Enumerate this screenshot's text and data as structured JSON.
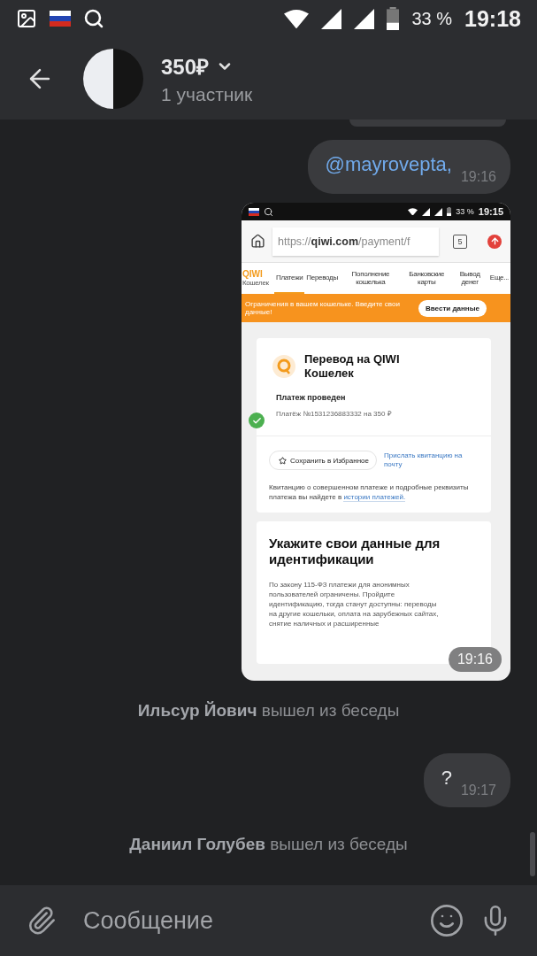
{
  "status_bar": {
    "battery": "33 %",
    "time": "19:18"
  },
  "header": {
    "title": "350₽",
    "subtitle": "1 участник"
  },
  "messages": [
    {
      "kind": "cut_off"
    },
    {
      "kind": "mention",
      "text": "@mayrovepta,",
      "time": "19:16"
    },
    {
      "kind": "screenshot",
      "time": "19:16",
      "screen": {
        "status_bar": {
          "battery": "33 %",
          "time": "19:15"
        },
        "browser": {
          "url": "https://**qiwi.com**/payment/f",
          "tab_count": "5"
        },
        "nav": {
          "logo": "QIWI",
          "logo_caption": "Кошелек",
          "items": [
            {
              "label": "Платежи",
              "selected": true
            },
            {
              "label": "Переводы",
              "selected": false
            },
            {
              "label": "Пополнение кошелька",
              "selected": false
            },
            {
              "label": "Банковские карты",
              "selected": false
            },
            {
              "label": "Вывод денег",
              "selected": false
            },
            {
              "label": "Еще...",
              "selected": false
            }
          ]
        },
        "banner": {
          "text": "Ограничения в вашем кошельке. Введите свои данные!",
          "button": "Ввести данные"
        },
        "payment_card": {
          "title": "Перевод на QIWI Кошелек",
          "status": "Платеж проведен",
          "detail": "Платёж №1531236883332 на 350 ₽",
          "save_button": "Сохранить в Избранное",
          "receipt_link": "Прислать квитанцию на почту",
          "note": "Квитанцию о совершенном платеже и подробные реквизиты платежа вы найдете в",
          "note_link": "истории платежей."
        },
        "identification_card": {
          "title": "Укажите свои данные для идентификации",
          "body": "По закону 115-ФЗ платежи для анонимных пользователей ограничены. Пройдите идентификацию, тогда станут доступны: переводы на другие кошельки, оплата на зарубежных сайтах, снятие наличных и расширенные"
        }
      }
    },
    {
      "kind": "system",
      "actor": "Ильсур Йович",
      "text": "вышел из беседы"
    },
    {
      "kind": "text",
      "text": "?",
      "time": "19:17"
    },
    {
      "kind": "system",
      "actor": "Даниил Голубев",
      "text": "вышел из беседы"
    }
  ],
  "composer": {
    "placeholder": "Сообщение"
  }
}
